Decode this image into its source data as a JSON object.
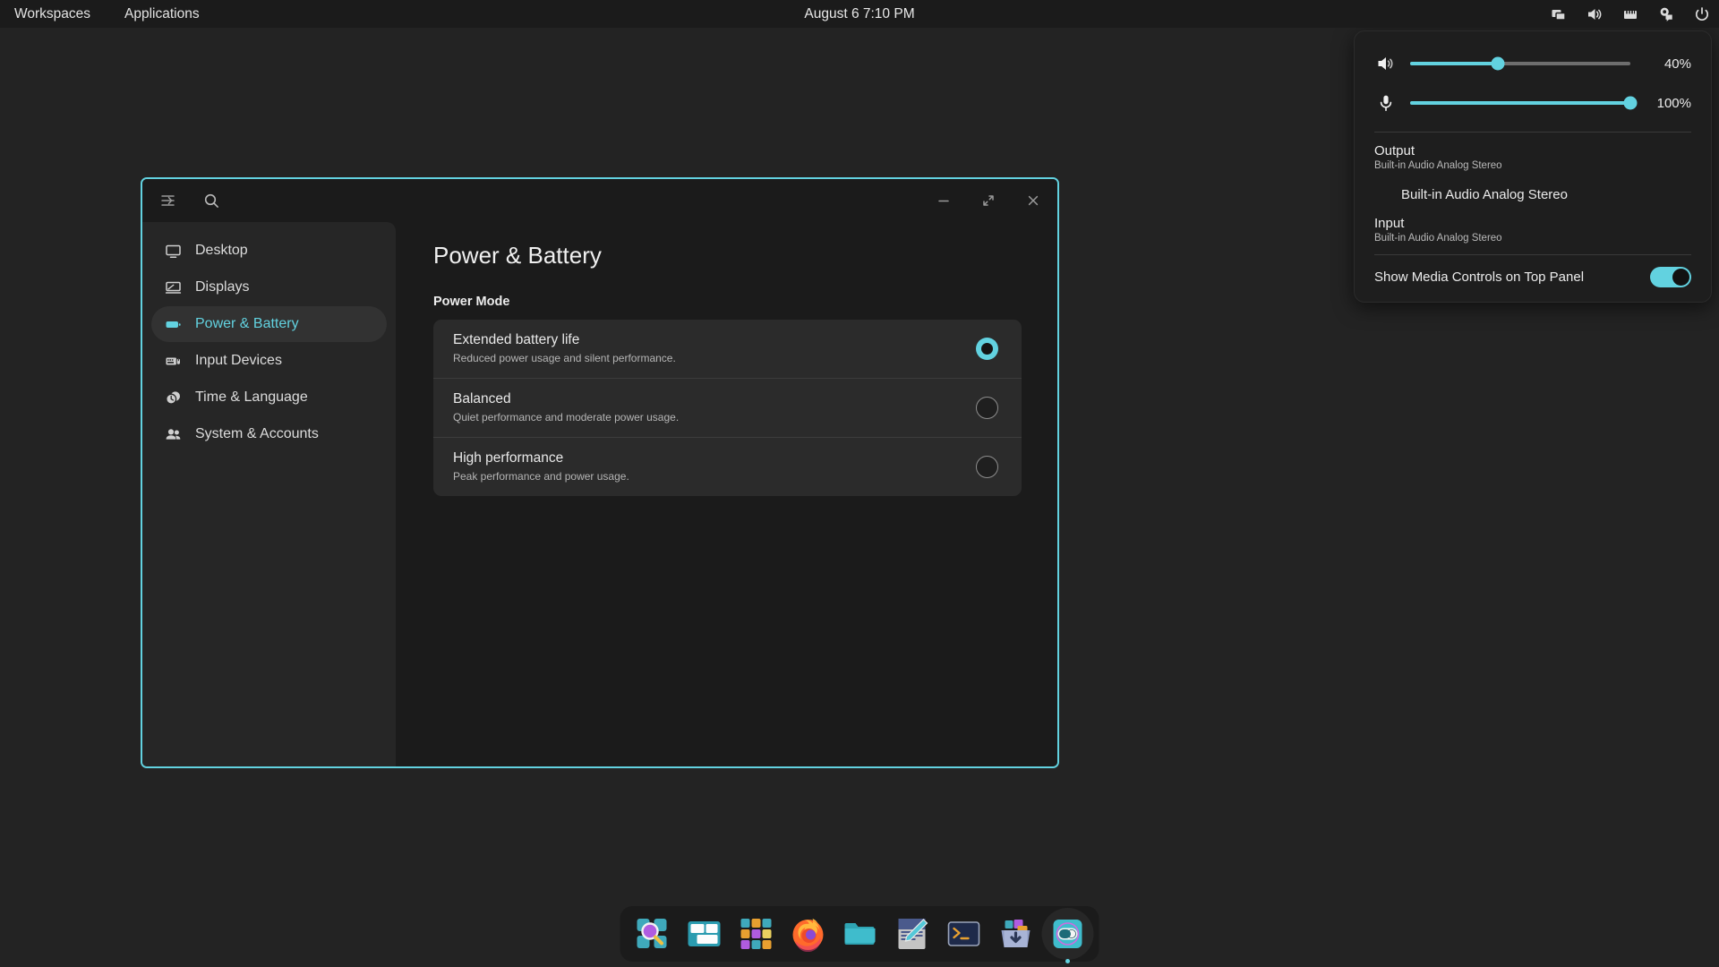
{
  "theme": {
    "accent": "#62d2e0",
    "desktop_bg": "#232323",
    "panel_bg": "#1b1b1b",
    "window_bg": "#1b1b1b",
    "sidebar_bg": "#262626",
    "card_bg": "#2b2b2b"
  },
  "top_panel": {
    "workspaces_label": "Workspaces",
    "applications_label": "Applications",
    "clock": "August 6 7:10 PM",
    "tray": [
      {
        "name": "display-windows-icon"
      },
      {
        "name": "volume-icon"
      },
      {
        "name": "network-icon"
      },
      {
        "name": "notifications-icon"
      },
      {
        "name": "power-icon"
      }
    ]
  },
  "audio_panel": {
    "output_slider": {
      "icon": "speaker-icon",
      "value": "40%",
      "percent": 40
    },
    "input_slider": {
      "icon": "microphone-icon",
      "value": "100%",
      "percent": 100
    },
    "output_title": "Output",
    "output_device": "Built-in Audio Analog Stereo",
    "output_selected_device": "Built-in Audio Analog Stereo",
    "input_title": "Input",
    "input_device": "Built-in Audio Analog Stereo",
    "media_controls_label": "Show Media Controls on Top Panel",
    "media_controls_on": true
  },
  "window": {
    "titlebar": {
      "sidebar_toggle_icon": "sidebar-collapse-icon",
      "search_icon": "search-icon",
      "minimize_icon": "minimize-icon",
      "maximize_icon": "maximize-icon",
      "close_icon": "close-icon"
    },
    "sidebar": {
      "items": [
        {
          "label": "Desktop",
          "icon": "monitor-icon",
          "active": false
        },
        {
          "label": "Displays",
          "icon": "display-icon",
          "active": false
        },
        {
          "label": "Power & Battery",
          "icon": "battery-icon",
          "active": true
        },
        {
          "label": "Input Devices",
          "icon": "keyboard-mouse-icon",
          "active": false
        },
        {
          "label": "Time & Language",
          "icon": "clock-globe-icon",
          "active": false
        },
        {
          "label": "System & Accounts",
          "icon": "people-icon",
          "active": false
        }
      ]
    },
    "content": {
      "page_title": "Power & Battery",
      "group_title": "Power Mode",
      "power_modes": [
        {
          "label": "Extended battery life",
          "desc": "Reduced power usage and silent performance.",
          "selected": true
        },
        {
          "label": "Balanced",
          "desc": "Quiet performance and moderate power usage.",
          "selected": false
        },
        {
          "label": "High performance",
          "desc": "Peak performance and power usage.",
          "selected": false
        }
      ]
    }
  },
  "dock": {
    "items": [
      {
        "name": "app-search-icon",
        "running": false
      },
      {
        "name": "window-overview-icon",
        "running": false
      },
      {
        "name": "app-grid-icon",
        "running": false
      },
      {
        "name": "firefox-icon",
        "running": false
      },
      {
        "name": "files-icon",
        "running": false
      },
      {
        "name": "text-editor-icon",
        "running": false
      },
      {
        "name": "terminal-icon",
        "running": false
      },
      {
        "name": "software-installer-icon",
        "running": false
      },
      {
        "name": "settings-icon",
        "running": true
      }
    ]
  }
}
